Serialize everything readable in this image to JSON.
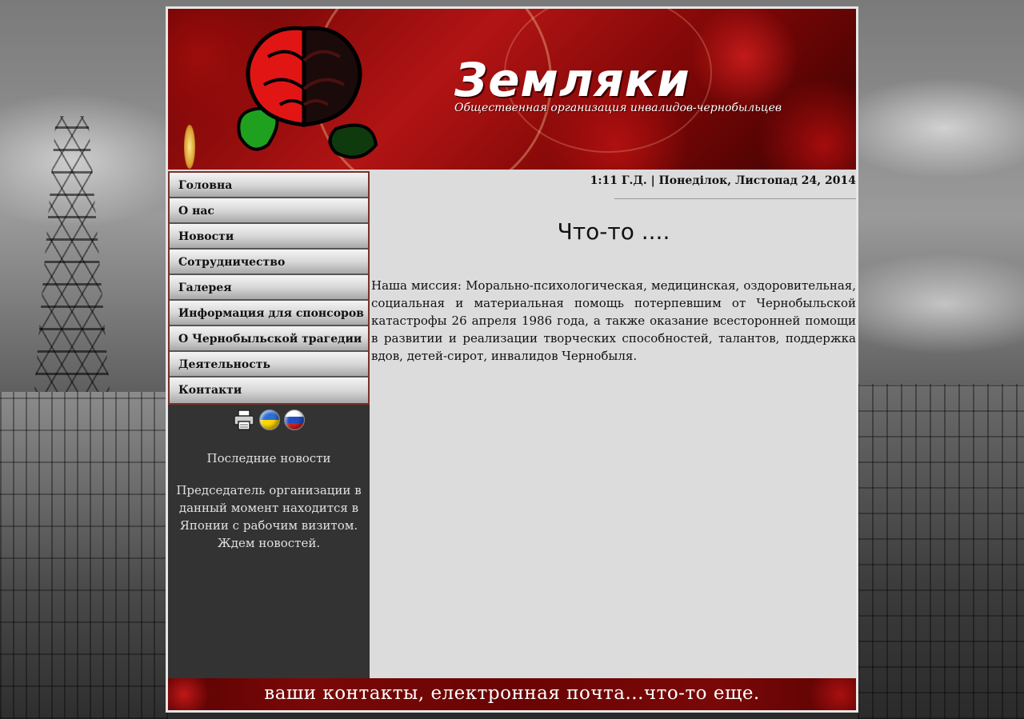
{
  "header": {
    "logo_title": "Земляки",
    "logo_subtitle": "Общественная организация инвалидов-чернобыльцев"
  },
  "menu": {
    "items": [
      {
        "label": "Головна"
      },
      {
        "label": "О нас"
      },
      {
        "label": "Новости"
      },
      {
        "label": "Сотрудничество"
      },
      {
        "label": "Галерея"
      },
      {
        "label": "Информация для спонсоров"
      },
      {
        "label": "О Чернобыльской трагедии"
      },
      {
        "label": "Деятельность"
      },
      {
        "label": "Контакти"
      }
    ]
  },
  "icons": [
    "printer-icon",
    "ukraine-flag-icon",
    "russia-flag-icon"
  ],
  "news": {
    "title": "Последние новости",
    "body": "Председатель организации в данный момент находится в Японии с рабочим визитом. Ждем новостей."
  },
  "content": {
    "date_line": "1:11 Г.Д. | Понеділок, Листопад 24, 2014",
    "heading": "Что-то ....",
    "mission": "Наша миссия: Морально-психологическая, медицинская, оздоровительная, социальная и материальная помощь потерпевшим от Чернобыльской катастрофы 26 апреля 1986 года, а также оказание всесторонней помощи в развитии и реализации творческих способностей, талантов, поддержка вдов, детей-сирот, инвалидов Чернобыля."
  },
  "footer": {
    "text": "ваши контакты, електронная почта...что-то еще."
  },
  "colors": {
    "header_red": "#b21414",
    "sidebar_bg": "#333333",
    "content_bg": "#dcdcdc",
    "menu_border": "#7a3028"
  }
}
